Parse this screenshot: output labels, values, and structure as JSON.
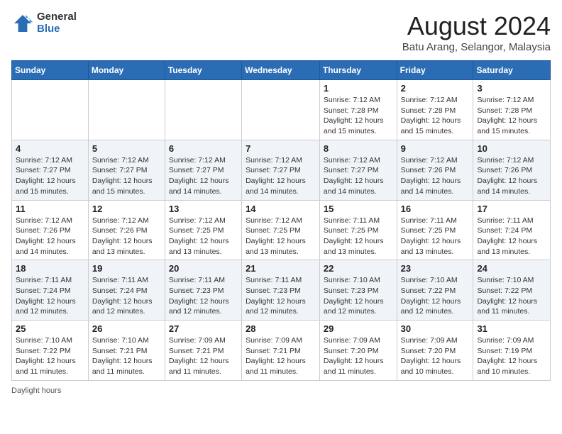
{
  "header": {
    "logo_general": "General",
    "logo_blue": "Blue",
    "month_year": "August 2024",
    "location": "Batu Arang, Selangor, Malaysia"
  },
  "days_of_week": [
    "Sunday",
    "Monday",
    "Tuesday",
    "Wednesday",
    "Thursday",
    "Friday",
    "Saturday"
  ],
  "weeks": [
    [
      {
        "day": "",
        "info": ""
      },
      {
        "day": "",
        "info": ""
      },
      {
        "day": "",
        "info": ""
      },
      {
        "day": "",
        "info": ""
      },
      {
        "day": "1",
        "info": "Sunrise: 7:12 AM\nSunset: 7:28 PM\nDaylight: 12 hours\nand 15 minutes."
      },
      {
        "day": "2",
        "info": "Sunrise: 7:12 AM\nSunset: 7:28 PM\nDaylight: 12 hours\nand 15 minutes."
      },
      {
        "day": "3",
        "info": "Sunrise: 7:12 AM\nSunset: 7:28 PM\nDaylight: 12 hours\nand 15 minutes."
      }
    ],
    [
      {
        "day": "4",
        "info": "Sunrise: 7:12 AM\nSunset: 7:27 PM\nDaylight: 12 hours\nand 15 minutes."
      },
      {
        "day": "5",
        "info": "Sunrise: 7:12 AM\nSunset: 7:27 PM\nDaylight: 12 hours\nand 15 minutes."
      },
      {
        "day": "6",
        "info": "Sunrise: 7:12 AM\nSunset: 7:27 PM\nDaylight: 12 hours\nand 14 minutes."
      },
      {
        "day": "7",
        "info": "Sunrise: 7:12 AM\nSunset: 7:27 PM\nDaylight: 12 hours\nand 14 minutes."
      },
      {
        "day": "8",
        "info": "Sunrise: 7:12 AM\nSunset: 7:27 PM\nDaylight: 12 hours\nand 14 minutes."
      },
      {
        "day": "9",
        "info": "Sunrise: 7:12 AM\nSunset: 7:26 PM\nDaylight: 12 hours\nand 14 minutes."
      },
      {
        "day": "10",
        "info": "Sunrise: 7:12 AM\nSunset: 7:26 PM\nDaylight: 12 hours\nand 14 minutes."
      }
    ],
    [
      {
        "day": "11",
        "info": "Sunrise: 7:12 AM\nSunset: 7:26 PM\nDaylight: 12 hours\nand 14 minutes."
      },
      {
        "day": "12",
        "info": "Sunrise: 7:12 AM\nSunset: 7:26 PM\nDaylight: 12 hours\nand 13 minutes."
      },
      {
        "day": "13",
        "info": "Sunrise: 7:12 AM\nSunset: 7:25 PM\nDaylight: 12 hours\nand 13 minutes."
      },
      {
        "day": "14",
        "info": "Sunrise: 7:12 AM\nSunset: 7:25 PM\nDaylight: 12 hours\nand 13 minutes."
      },
      {
        "day": "15",
        "info": "Sunrise: 7:11 AM\nSunset: 7:25 PM\nDaylight: 12 hours\nand 13 minutes."
      },
      {
        "day": "16",
        "info": "Sunrise: 7:11 AM\nSunset: 7:25 PM\nDaylight: 12 hours\nand 13 minutes."
      },
      {
        "day": "17",
        "info": "Sunrise: 7:11 AM\nSunset: 7:24 PM\nDaylight: 12 hours\nand 13 minutes."
      }
    ],
    [
      {
        "day": "18",
        "info": "Sunrise: 7:11 AM\nSunset: 7:24 PM\nDaylight: 12 hours\nand 12 minutes."
      },
      {
        "day": "19",
        "info": "Sunrise: 7:11 AM\nSunset: 7:24 PM\nDaylight: 12 hours\nand 12 minutes."
      },
      {
        "day": "20",
        "info": "Sunrise: 7:11 AM\nSunset: 7:23 PM\nDaylight: 12 hours\nand 12 minutes."
      },
      {
        "day": "21",
        "info": "Sunrise: 7:11 AM\nSunset: 7:23 PM\nDaylight: 12 hours\nand 12 minutes."
      },
      {
        "day": "22",
        "info": "Sunrise: 7:10 AM\nSunset: 7:23 PM\nDaylight: 12 hours\nand 12 minutes."
      },
      {
        "day": "23",
        "info": "Sunrise: 7:10 AM\nSunset: 7:22 PM\nDaylight: 12 hours\nand 12 minutes."
      },
      {
        "day": "24",
        "info": "Sunrise: 7:10 AM\nSunset: 7:22 PM\nDaylight: 12 hours\nand 11 minutes."
      }
    ],
    [
      {
        "day": "25",
        "info": "Sunrise: 7:10 AM\nSunset: 7:22 PM\nDaylight: 12 hours\nand 11 minutes."
      },
      {
        "day": "26",
        "info": "Sunrise: 7:10 AM\nSunset: 7:21 PM\nDaylight: 12 hours\nand 11 minutes."
      },
      {
        "day": "27",
        "info": "Sunrise: 7:09 AM\nSunset: 7:21 PM\nDaylight: 12 hours\nand 11 minutes."
      },
      {
        "day": "28",
        "info": "Sunrise: 7:09 AM\nSunset: 7:21 PM\nDaylight: 12 hours\nand 11 minutes."
      },
      {
        "day": "29",
        "info": "Sunrise: 7:09 AM\nSunset: 7:20 PM\nDaylight: 12 hours\nand 11 minutes."
      },
      {
        "day": "30",
        "info": "Sunrise: 7:09 AM\nSunset: 7:20 PM\nDaylight: 12 hours\nand 10 minutes."
      },
      {
        "day": "31",
        "info": "Sunrise: 7:09 AM\nSunset: 7:19 PM\nDaylight: 12 hours\nand 10 minutes."
      }
    ]
  ],
  "footer": {
    "daylight_label": "Daylight hours"
  }
}
